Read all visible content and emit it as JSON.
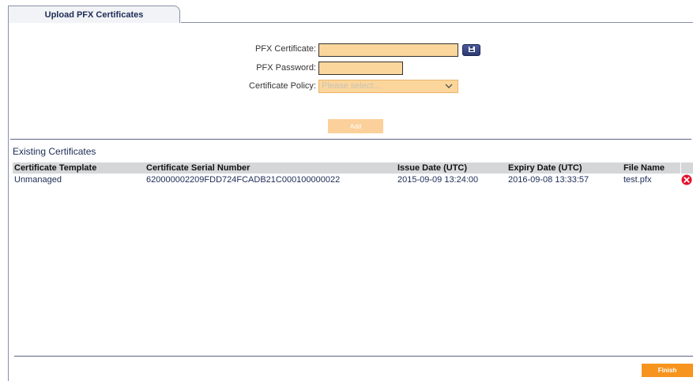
{
  "tab": {
    "label": "Upload PFX Certificates"
  },
  "form": {
    "certificate_label": "PFX Certificate:",
    "certificate_value": "",
    "password_label": "PFX Password:",
    "password_value": "",
    "policy_label": "Certificate Policy:",
    "policy_placeholder": "Please select...",
    "add_label": "Add"
  },
  "existing": {
    "title": "Existing Certificates",
    "columns": [
      "Certificate Template",
      "Certificate Serial Number",
      "Issue Date (UTC)",
      "Expiry Date (UTC)",
      "File Name"
    ],
    "rows": [
      {
        "template": "Unmanaged",
        "serial": "620000002209FDD724FCADB21C000100000022",
        "issue": "2015-09-09 13:24:00",
        "expiry": "2016-09-08 13:33:57",
        "file": "test.pfx"
      }
    ]
  },
  "footer": {
    "finish_label": "Finish"
  },
  "colors": {
    "accent": "#f7941d",
    "field_bg": "#fbd69c",
    "header_bg": "#d5d6d8",
    "tab_text": "#1c2b55",
    "delete": "#e3122b"
  },
  "icons": {
    "browse": "folder-browse-icon",
    "delete": "delete-icon",
    "dropdown": "chevron-down-icon"
  }
}
